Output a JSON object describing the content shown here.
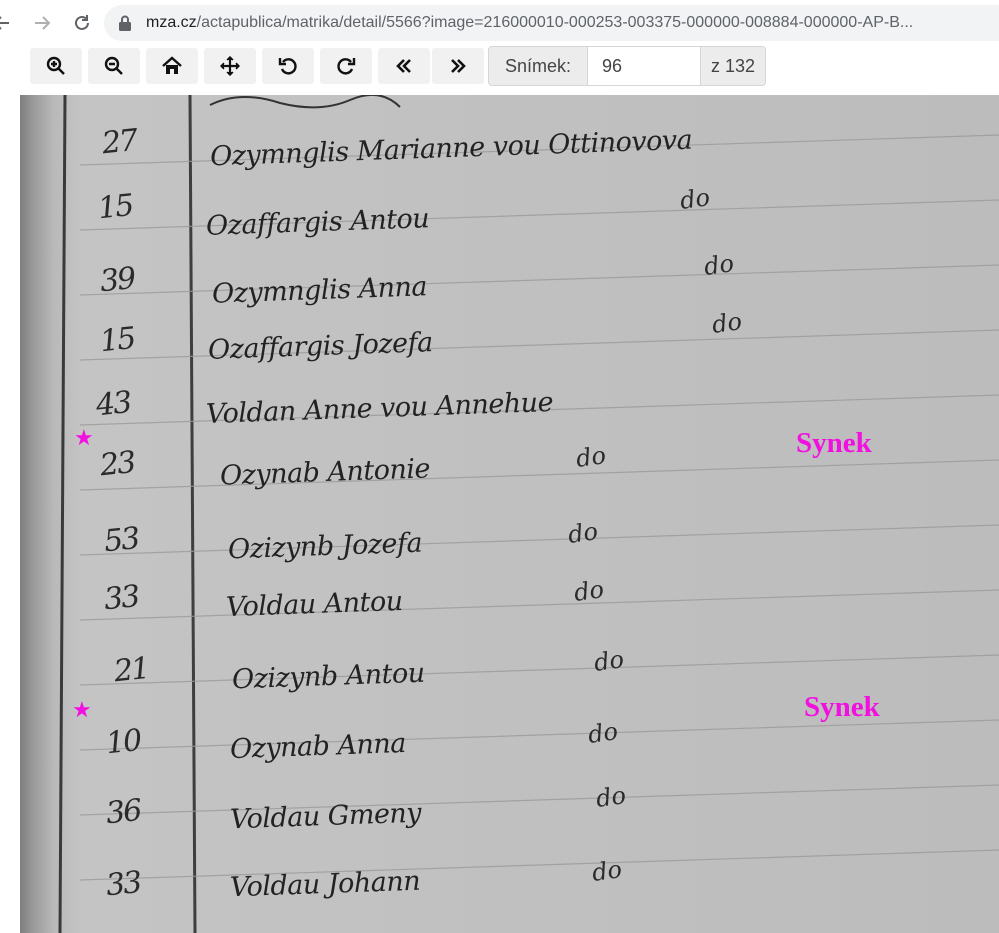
{
  "browser": {
    "url_host": "mza.cz",
    "url_path": "/actapublica/matrika/detail/5566?image=216000010-000253-003375-000000-008884-000000-AP-B..."
  },
  "viewer": {
    "tools": [
      "zoom-in",
      "zoom-out",
      "home",
      "move",
      "rotate-left",
      "rotate-right",
      "first-page",
      "next-page"
    ],
    "page_label": "Snímek:",
    "page_value": "96",
    "page_total": "z 132"
  },
  "document": {
    "rows": [
      {
        "age": "27",
        "name": "Ozymnglis Marianne vou Ottinovova",
        "ditto": ""
      },
      {
        "age": "15",
        "name": "Ozaffargis Antou",
        "ditto": "do"
      },
      {
        "age": "39",
        "name": "Ozymnglis Anna",
        "ditto": "do"
      },
      {
        "age": "15",
        "name": "Ozaffargis Jozefa",
        "ditto": "do"
      },
      {
        "age": "43",
        "name": "Voldan Anne vou Annehue",
        "ditto": ""
      },
      {
        "age": "23",
        "name": "Ozynab Antonie",
        "ditto": "do"
      },
      {
        "age": "53",
        "name": "Ozizynb Jozefa",
        "ditto": "do"
      },
      {
        "age": "33",
        "name": "Voldau Antou",
        "ditto": "do"
      },
      {
        "age": "21",
        "name": "Ozizynb Antou",
        "ditto": "do"
      },
      {
        "age": "10",
        "name": "Ozynab Anna",
        "ditto": "do"
      },
      {
        "age": "36",
        "name": "Voldau Gmeny",
        "ditto": "do"
      },
      {
        "age": "33",
        "name": "Voldau Johann",
        "ditto": "do"
      }
    ],
    "annotations": [
      {
        "text": "Synek",
        "marker": "★"
      },
      {
        "text": "Synek",
        "marker": "★"
      }
    ],
    "annotation_color": "#f210e0"
  }
}
